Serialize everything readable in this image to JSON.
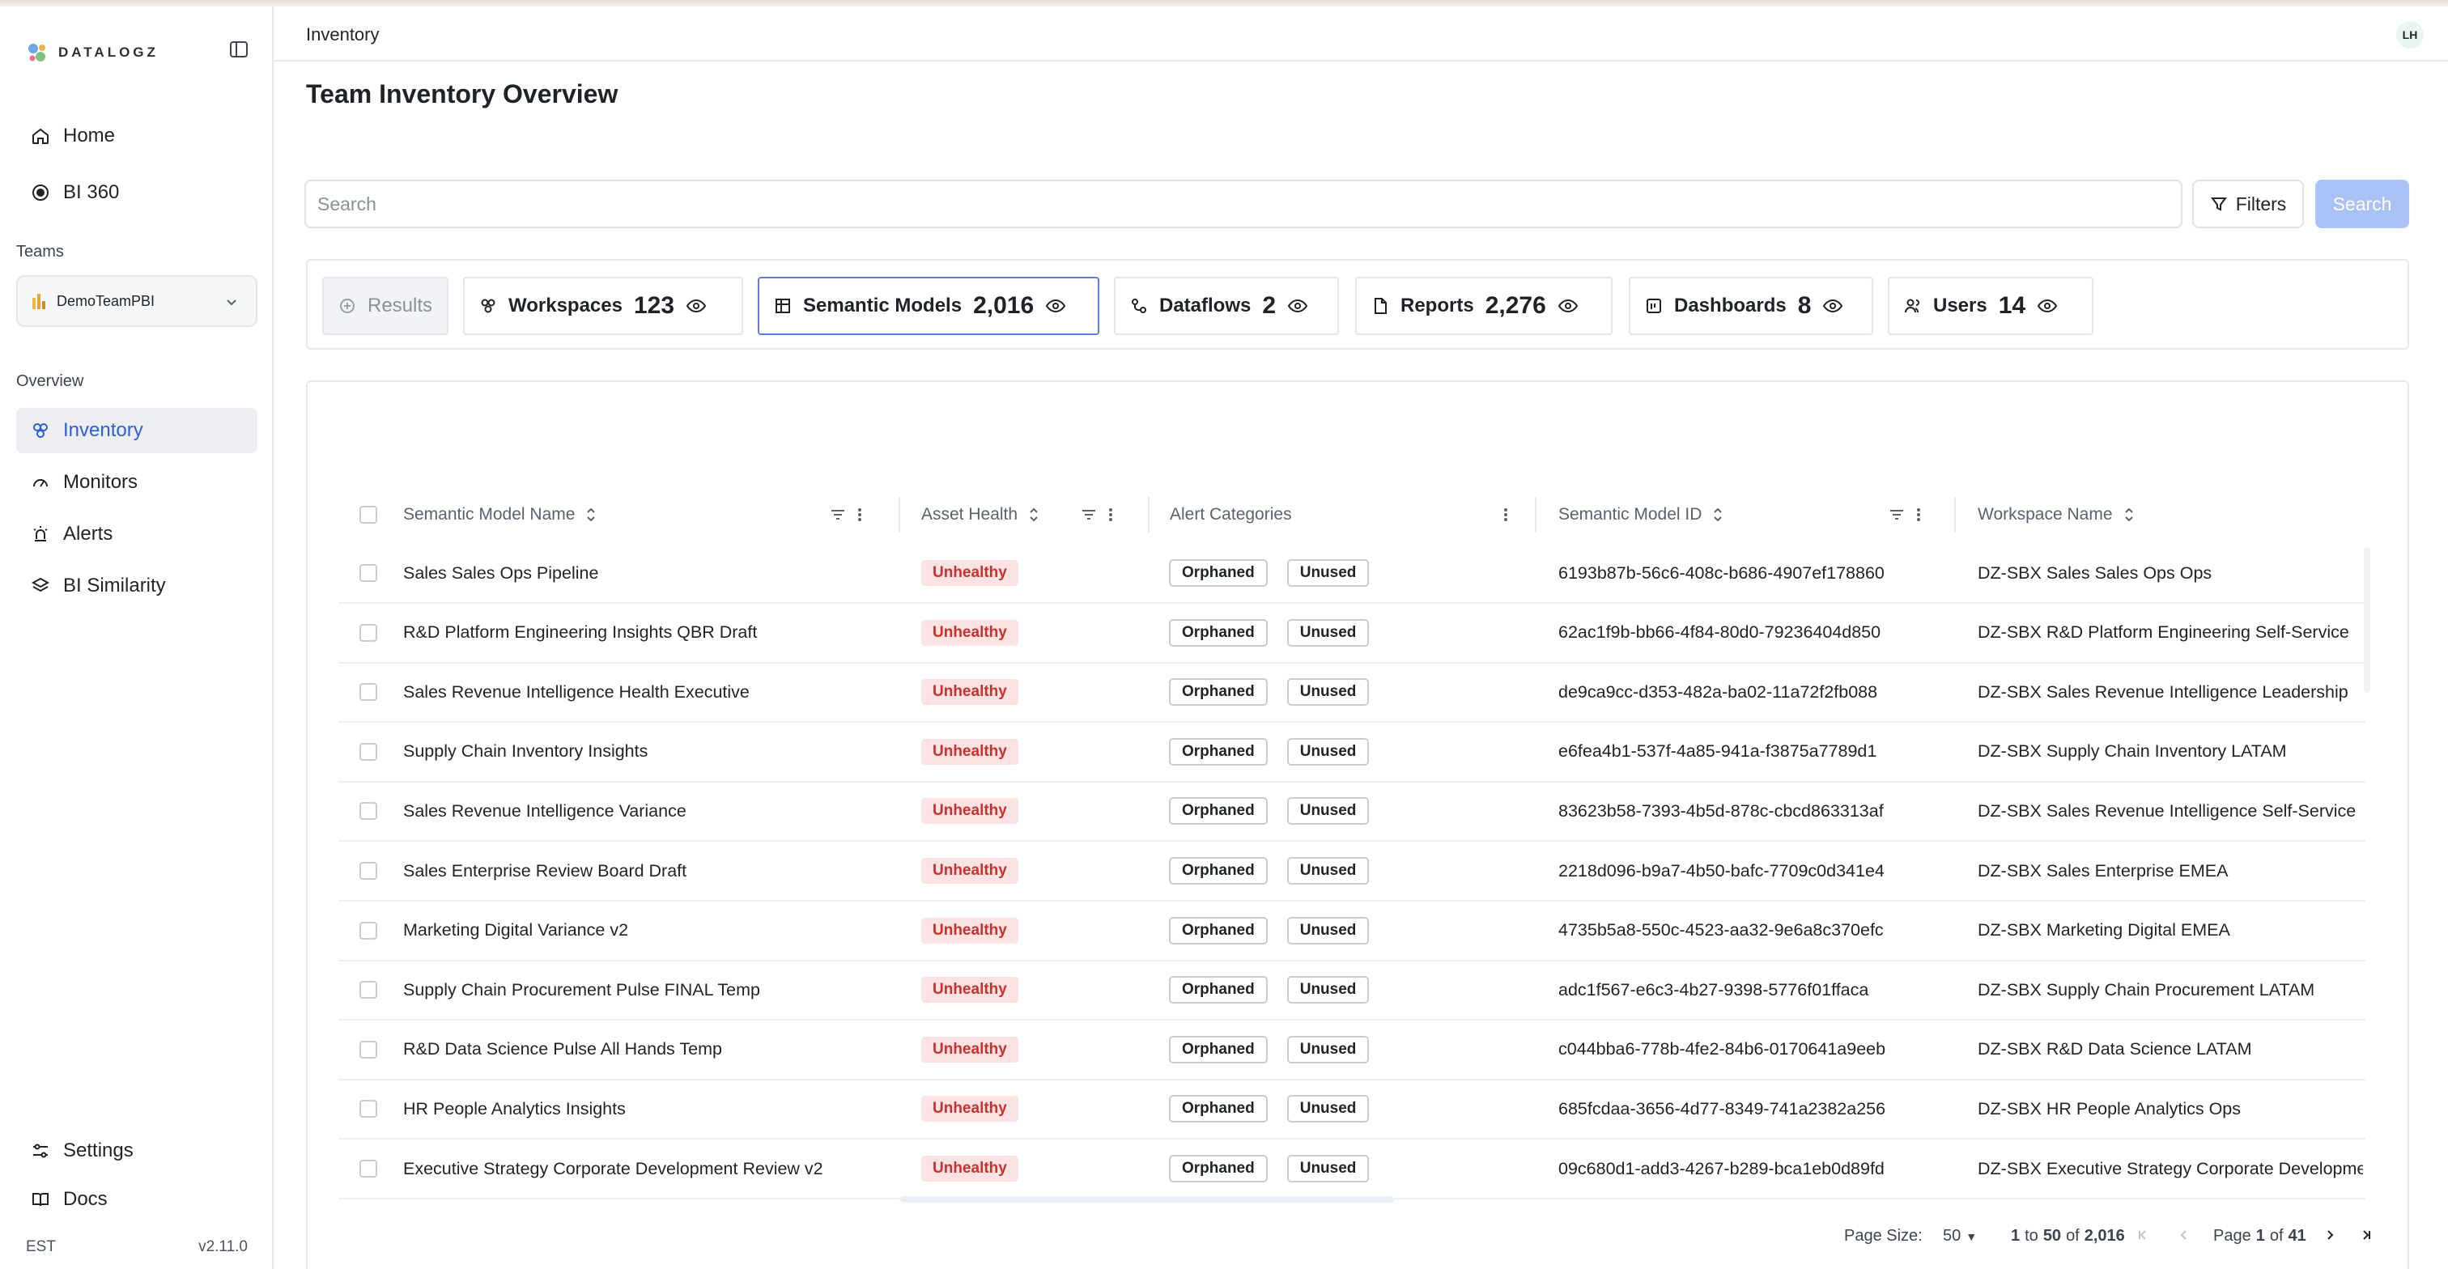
{
  "app": {
    "logo_text": "DATALOGZ",
    "version": "v2.11.0",
    "timezone": "EST"
  },
  "sidebar": {
    "nav": [
      {
        "label": "Home",
        "icon": "home-icon"
      },
      {
        "label": "BI 360",
        "icon": "target-icon"
      }
    ],
    "teams_label": "Teams",
    "team_selected": "DemoTeamPBI",
    "overview_label": "Overview",
    "overview_items": [
      {
        "label": "Inventory",
        "icon": "inventory-icon",
        "active": true
      },
      {
        "label": "Monitors",
        "icon": "gauge-icon"
      },
      {
        "label": "Alerts",
        "icon": "siren-icon"
      },
      {
        "label": "BI Similarity",
        "icon": "layers-icon"
      }
    ],
    "settings_label": "Settings",
    "docs_label": "Docs"
  },
  "header": {
    "breadcrumb": "Inventory",
    "avatar_initials": "LH"
  },
  "page": {
    "title": "Team Inventory Overview"
  },
  "search": {
    "placeholder": "Search",
    "filters_label": "Filters",
    "search_label": "Search"
  },
  "tabs": [
    {
      "label": "Results",
      "count": ""
    },
    {
      "label": "Workspaces",
      "count": "123"
    },
    {
      "label": "Semantic Models",
      "count": "2,016"
    },
    {
      "label": "Dataflows",
      "count": "2"
    },
    {
      "label": "Reports",
      "count": "2,276"
    },
    {
      "label": "Dashboards",
      "count": "8"
    },
    {
      "label": "Users",
      "count": "14"
    }
  ],
  "table": {
    "columns": [
      "Semantic Model Name",
      "Asset Health",
      "Alert Categories",
      "Semantic Model ID",
      "Workspace Name"
    ],
    "rows": [
      {
        "name": "Sales Sales Ops Pipeline",
        "health": "Unhealthy",
        "tags": [
          "Orphaned",
          "Unused"
        ],
        "id": "6193b87b-56c6-408c-b686-4907ef178860",
        "workspace": "DZ-SBX Sales Sales Ops Ops"
      },
      {
        "name": "R&D Platform Engineering Insights QBR Draft",
        "health": "Unhealthy",
        "tags": [
          "Orphaned",
          "Unused"
        ],
        "id": "62ac1f9b-bb66-4f84-80d0-79236404d850",
        "workspace": "DZ-SBX R&D Platform Engineering Self-Service"
      },
      {
        "name": "Sales Revenue Intelligence Health Executive",
        "health": "Unhealthy",
        "tags": [
          "Orphaned",
          "Unused"
        ],
        "id": "de9ca9cc-d353-482a-ba02-11a72f2fb088",
        "workspace": "DZ-SBX Sales Revenue Intelligence Leadership"
      },
      {
        "name": "Supply Chain Inventory Insights",
        "health": "Unhealthy",
        "tags": [
          "Orphaned",
          "Unused"
        ],
        "id": "e6fea4b1-537f-4a85-941a-f3875a7789d1",
        "workspace": "DZ-SBX Supply Chain Inventory LATAM"
      },
      {
        "name": "Sales Revenue Intelligence Variance",
        "health": "Unhealthy",
        "tags": [
          "Orphaned",
          "Unused"
        ],
        "id": "83623b58-7393-4b5d-878c-cbcd863313af",
        "workspace": "DZ-SBX Sales Revenue Intelligence Self-Service"
      },
      {
        "name": "Sales Enterprise Review Board Draft",
        "health": "Unhealthy",
        "tags": [
          "Orphaned",
          "Unused"
        ],
        "id": "2218d096-b9a7-4b50-bafc-7709c0d341e4",
        "workspace": "DZ-SBX Sales Enterprise EMEA"
      },
      {
        "name": "Marketing Digital Variance v2",
        "health": "Unhealthy",
        "tags": [
          "Orphaned",
          "Unused"
        ],
        "id": "4735b5a8-550c-4523-aa32-9e6a8c370efc",
        "workspace": "DZ-SBX Marketing Digital EMEA"
      },
      {
        "name": "Supply Chain Procurement Pulse FINAL Temp",
        "health": "Unhealthy",
        "tags": [
          "Orphaned",
          "Unused"
        ],
        "id": "adc1f567-e6c3-4b27-9398-5776f01ffaca",
        "workspace": "DZ-SBX Supply Chain Procurement LATAM"
      },
      {
        "name": "R&D Data Science Pulse All Hands Temp",
        "health": "Unhealthy",
        "tags": [
          "Orphaned",
          "Unused"
        ],
        "id": "c044bba6-778b-4fe2-84b6-0170641a9eeb",
        "workspace": "DZ-SBX R&D Data Science LATAM"
      },
      {
        "name": "HR People Analytics Insights",
        "health": "Unhealthy",
        "tags": [
          "Orphaned",
          "Unused"
        ],
        "id": "685fcdaa-3656-4d77-8349-741a2382a256",
        "workspace": "DZ-SBX HR People Analytics Ops"
      },
      {
        "name": "Executive Strategy Corporate Development Review v2",
        "health": "Unhealthy",
        "tags": [
          "Orphaned",
          "Unused"
        ],
        "id": "09c680d1-add3-4267-b289-bca1eb0d89fd",
        "workspace": "DZ-SBX Executive Strategy Corporate Development"
      }
    ]
  },
  "pagination": {
    "page_size_label": "Page Size:",
    "page_size": "50",
    "range_from": "1",
    "range_to": "50",
    "range_total": "2,016",
    "page_current": "1",
    "page_total": "41"
  },
  "colors": {
    "accent": "#2c5fd6",
    "unhealthy_bg": "#fbe3e3",
    "unhealthy_text": "#c8312e",
    "search_button": "#a9c1f5"
  }
}
